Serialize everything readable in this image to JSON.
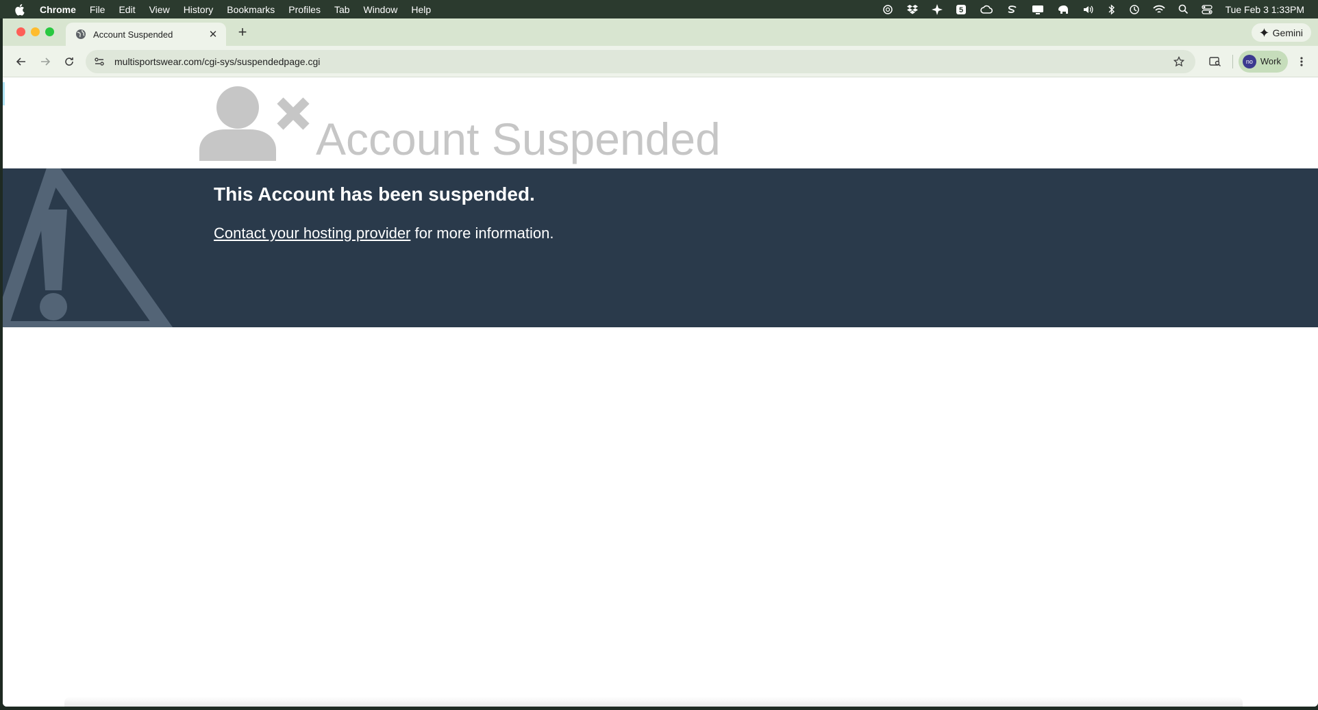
{
  "menubar": {
    "app": "Chrome",
    "items": [
      "File",
      "Edit",
      "View",
      "History",
      "Bookmarks",
      "Profiles",
      "Tab",
      "Window",
      "Help"
    ],
    "clock": "Tue Feb 3  1:33PM"
  },
  "browser": {
    "tab_title": "Account Suspended",
    "gemini_label": "Gemini",
    "url": "multisportswear.com/cgi-sys/suspendedpage.cgi",
    "profile_initials": "no",
    "profile_label": "Work"
  },
  "page": {
    "heading": "Account Suspended",
    "banner_title": "This Account has been suspended.",
    "contact_link": "Contact your hosting provider",
    "contact_suffix": " for more information."
  },
  "colors": {
    "banner_bg": "#2a3a4b",
    "heading_gray": "#c6c6c6",
    "tabstrip": "#d8e5d0"
  }
}
